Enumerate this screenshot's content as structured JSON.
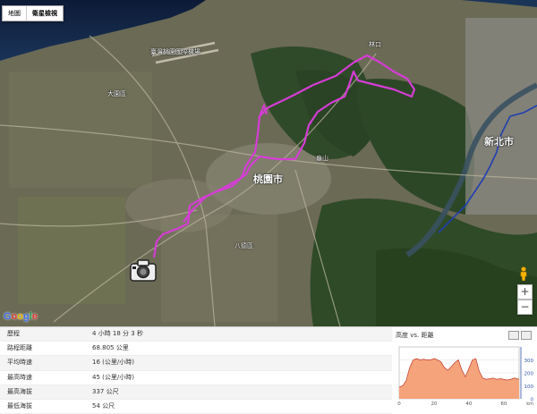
{
  "map": {
    "type_buttons": [
      "地圖",
      "衛星檢視"
    ],
    "zoom_in": "+",
    "zoom_out": "−",
    "labels": {
      "airport": "臺灣桃園國際機場",
      "city_taoyuan": "桃園市",
      "city_newtaipei": "新北市",
      "linkou": "林口",
      "guishan": "龜山",
      "bade": "八德區",
      "dayuan": "大園區"
    }
  },
  "stats": [
    {
      "label": "歷程",
      "value": "4 小時 18 分 3 秒"
    },
    {
      "label": "路程距離",
      "value": "68.805 公里"
    },
    {
      "label": "平均時速",
      "value": "16 (公里/小時)"
    },
    {
      "label": "最高時速",
      "value": "45 (公里/小時)"
    },
    {
      "label": "最高海拔",
      "value": "337 公尺"
    },
    {
      "label": "最低海拔",
      "value": "54 公尺"
    }
  ],
  "chart": {
    "title": "高度 vs. 距離",
    "y_axis_color": "#3355aa",
    "fill_color": "#f4a37a",
    "line_color": "#c0392b"
  },
  "chart_data": {
    "type": "area",
    "title": "高度 vs. 距離",
    "xlabel": "km",
    "ylabel": "",
    "xlim": [
      0,
      68.8
    ],
    "ylim": [
      0,
      400
    ],
    "x_ticks": [
      0,
      20,
      40,
      60
    ],
    "y_ticks": [
      0,
      100,
      200,
      300
    ],
    "x": [
      0,
      2,
      4,
      6,
      8,
      10,
      12,
      14,
      16,
      18,
      20,
      22,
      24,
      26,
      28,
      30,
      32,
      34,
      36,
      38,
      40,
      42,
      44,
      46,
      48,
      50,
      52,
      54,
      56,
      58,
      60,
      62,
      64,
      66,
      68.8
    ],
    "series": [
      {
        "values": [
          90,
          100,
          140,
          240,
          300,
          310,
          300,
          305,
          300,
          300,
          310,
          300,
          285,
          240,
          220,
          250,
          280,
          300,
          220,
          170,
          235,
          300,
          310,
          210,
          160,
          150,
          155,
          160,
          150,
          155,
          150,
          145,
          150,
          160,
          150
        ]
      }
    ]
  }
}
